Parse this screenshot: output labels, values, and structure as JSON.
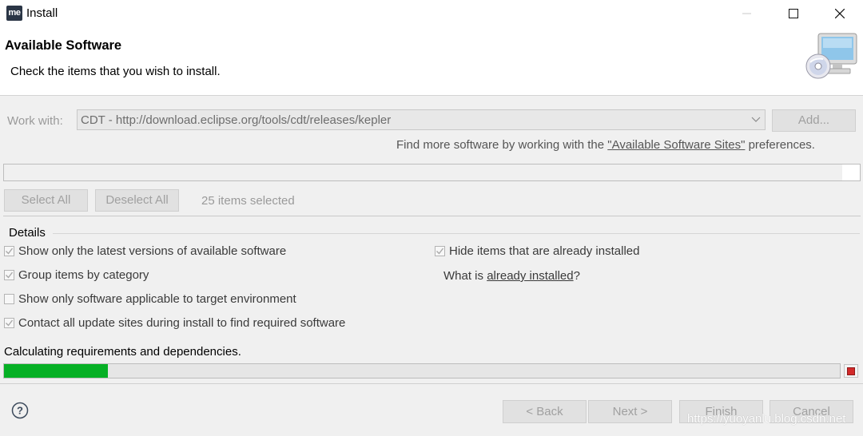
{
  "window": {
    "title": "Install",
    "app_icon_text": "me"
  },
  "header": {
    "title": "Available Software",
    "description": "Check the items that you wish to install."
  },
  "work_with": {
    "label": "Work with:",
    "value": "CDT - http://download.eclipse.org/tools/cdt/releases/kepler",
    "add_label": "Add..."
  },
  "find_more": {
    "prefix": "Find more software by working with the ",
    "link": "\"Available Software Sites\"",
    "suffix": " preferences."
  },
  "selection": {
    "select_all": "Select All",
    "deselect_all": "Deselect All",
    "count_text": "25 items selected"
  },
  "details": {
    "label": "Details",
    "options": {
      "latest": {
        "label": "Show only the latest versions of available software",
        "checked": true
      },
      "group": {
        "label": "Group items by category",
        "checked": true
      },
      "target": {
        "label": "Show only software applicable to target environment",
        "checked": false
      },
      "contact": {
        "label": "Contact all update sites during install to find required software",
        "checked": true
      },
      "hide": {
        "label": "Hide items that are already installed",
        "checked": true
      }
    },
    "what_is": {
      "prefix": "What is ",
      "link": "already installed",
      "suffix": "?"
    }
  },
  "progress": {
    "text": "Calculating requirements and dependencies.",
    "fraction": 0.124,
    "color": "#06b025"
  },
  "footer": {
    "back": "< Back",
    "next": "Next >",
    "finish": "Finish",
    "cancel": "Cancel"
  },
  "watermark": "https://yuoyanlu.blog.csdn.net"
}
